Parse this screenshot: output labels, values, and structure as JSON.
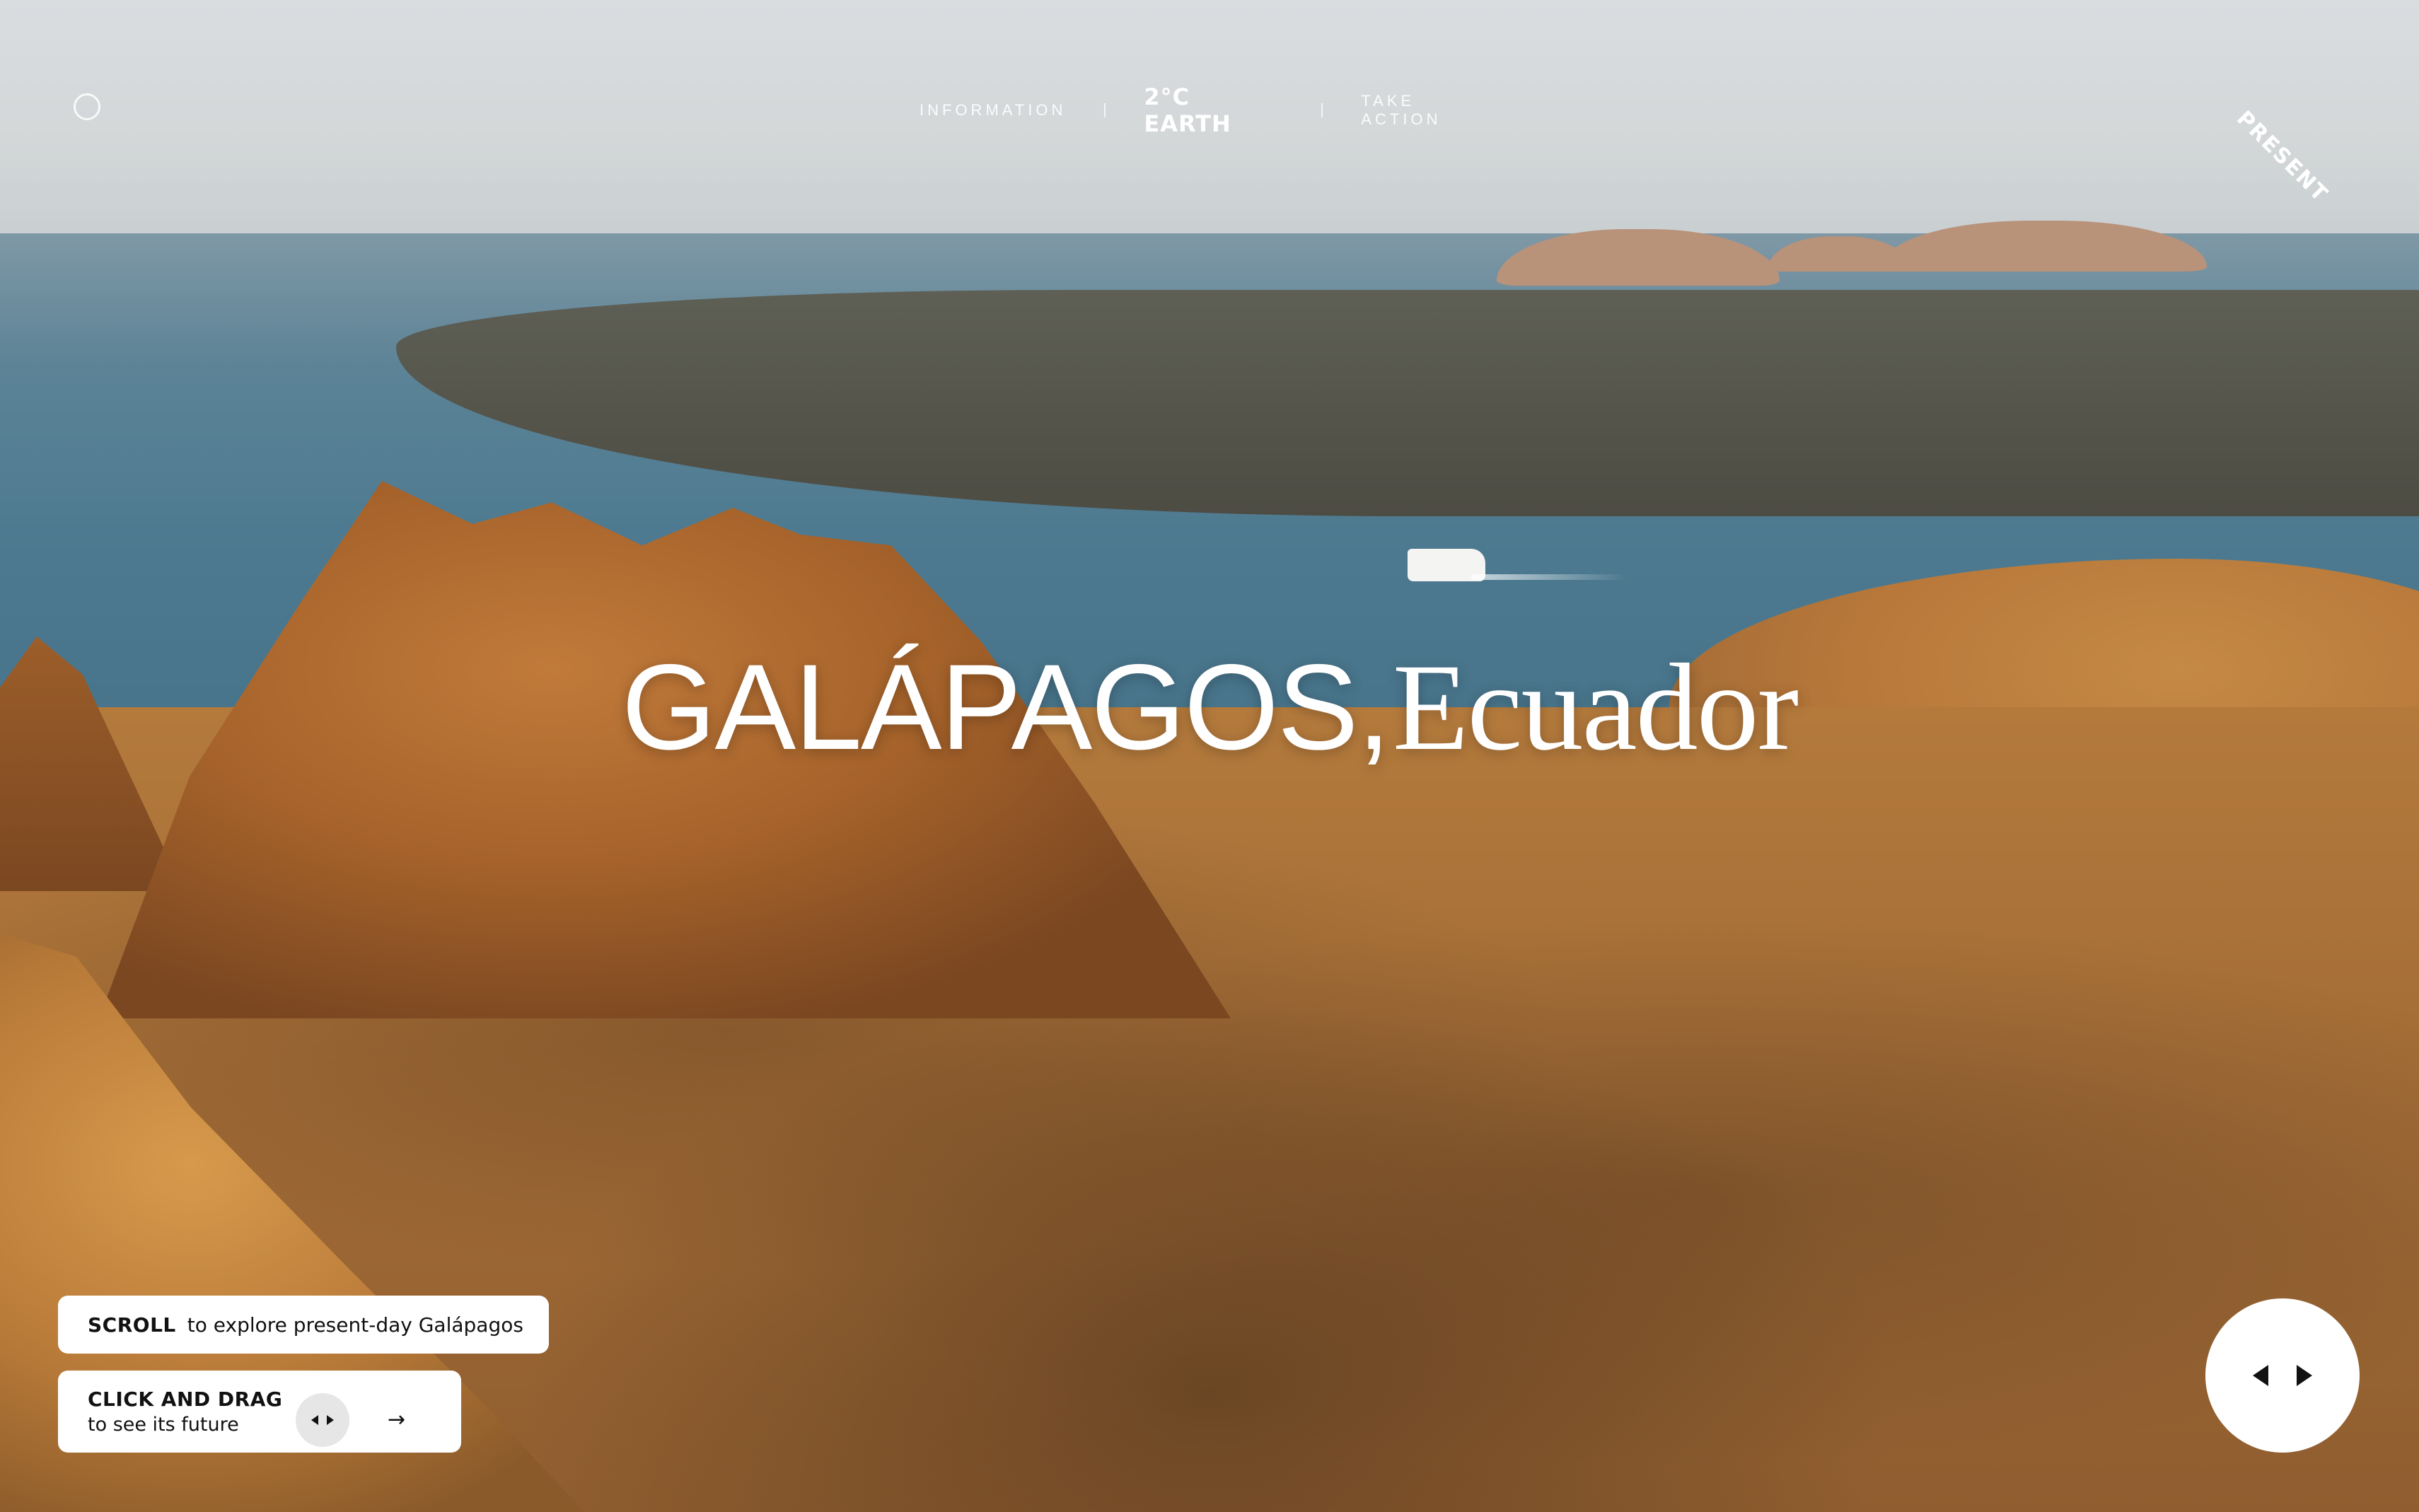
{
  "nav": {
    "information_label": "INFORMATION",
    "logo_label": "2°C EARTH",
    "take_action_label": "TAKE ACTION",
    "era_tag": "PRESENT"
  },
  "hero": {
    "place": "GALÁPAGOS,",
    "country": "Ecuador"
  },
  "hints": {
    "scroll_strong": "SCROLL",
    "scroll_text": "to explore present-day Galápagos",
    "drag_strong": "CLICK AND DRAG",
    "drag_text": "to see its future",
    "arrow_glyph": "→"
  },
  "icons": {
    "menu": "menu-circle-icon",
    "mini_toggle": "left-right-toggle-icon",
    "arrow": "arrow-right-icon",
    "big_toggle": "left-right-toggle-icon"
  },
  "colors": {
    "text_light": "#ffffff",
    "card_bg": "#ffffff",
    "card_text": "#111111"
  }
}
